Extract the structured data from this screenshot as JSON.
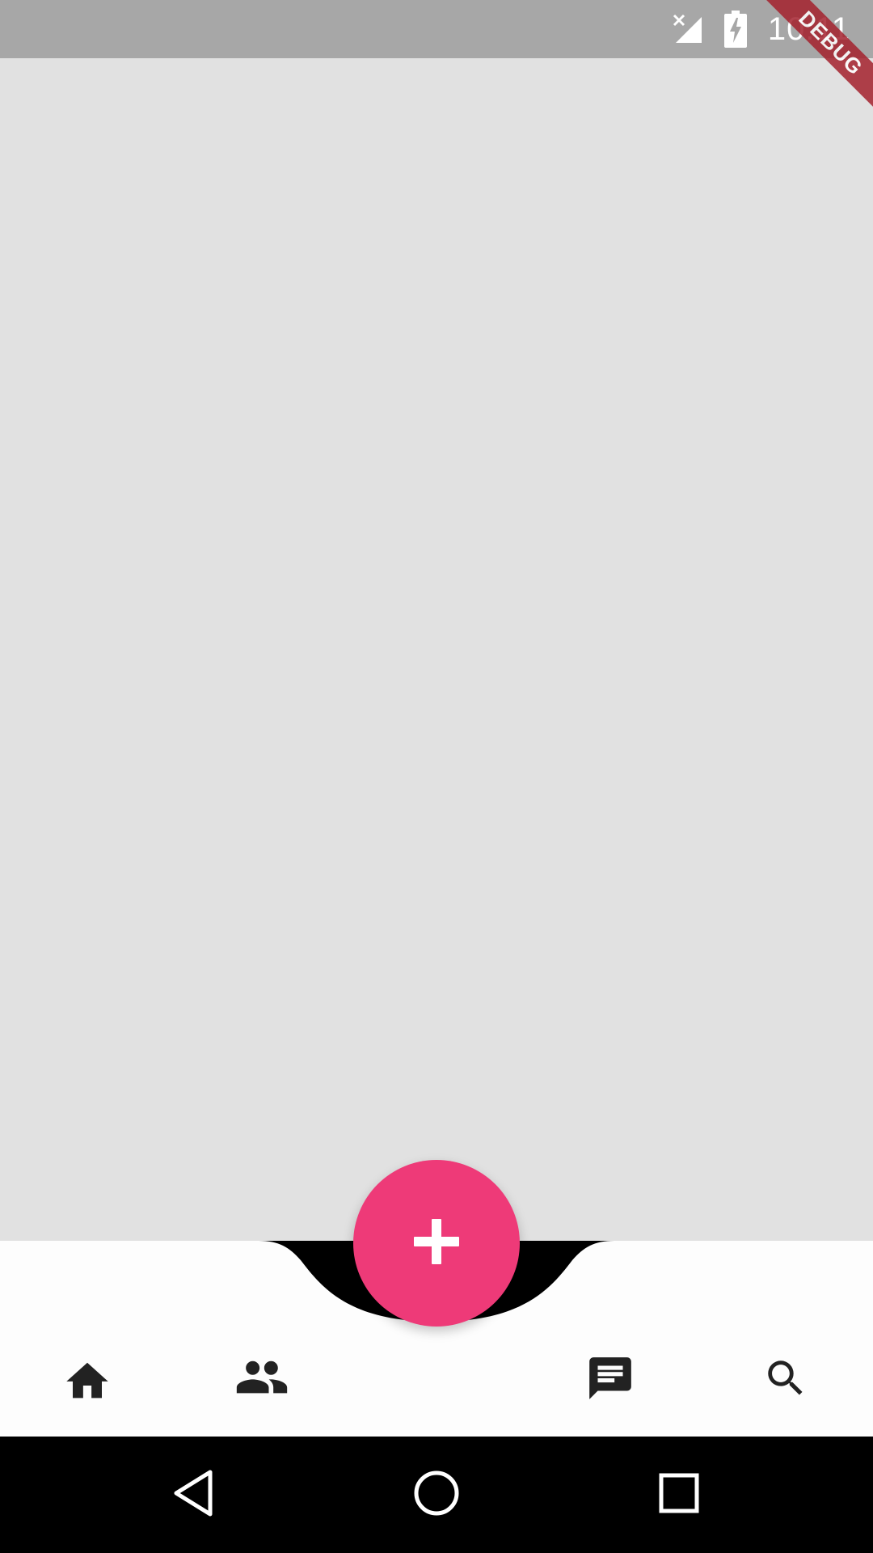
{
  "status_bar": {
    "time": "10:11",
    "signal_icon": "signal-no-data-icon",
    "battery_icon": "battery-charging-icon"
  },
  "debug_banner": {
    "label": "DEBUG"
  },
  "fab": {
    "icon": "add-icon",
    "color": "#ee3a78"
  },
  "bottom_nav": {
    "items": [
      {
        "icon": "home-icon"
      },
      {
        "icon": "people-icon"
      },
      {
        "icon": "chat-icon"
      },
      {
        "icon": "search-icon"
      }
    ]
  },
  "system_nav": {
    "back_icon": "back-triangle-icon",
    "home_icon": "home-circle-icon",
    "recents_icon": "recents-square-icon"
  },
  "colors": {
    "status_bar": "#a7a7a7",
    "content_background": "#e1e1e1",
    "bottom_bar": "#fdfdfd",
    "icon": "#222222",
    "debug_ribbon": "#a4222e"
  }
}
